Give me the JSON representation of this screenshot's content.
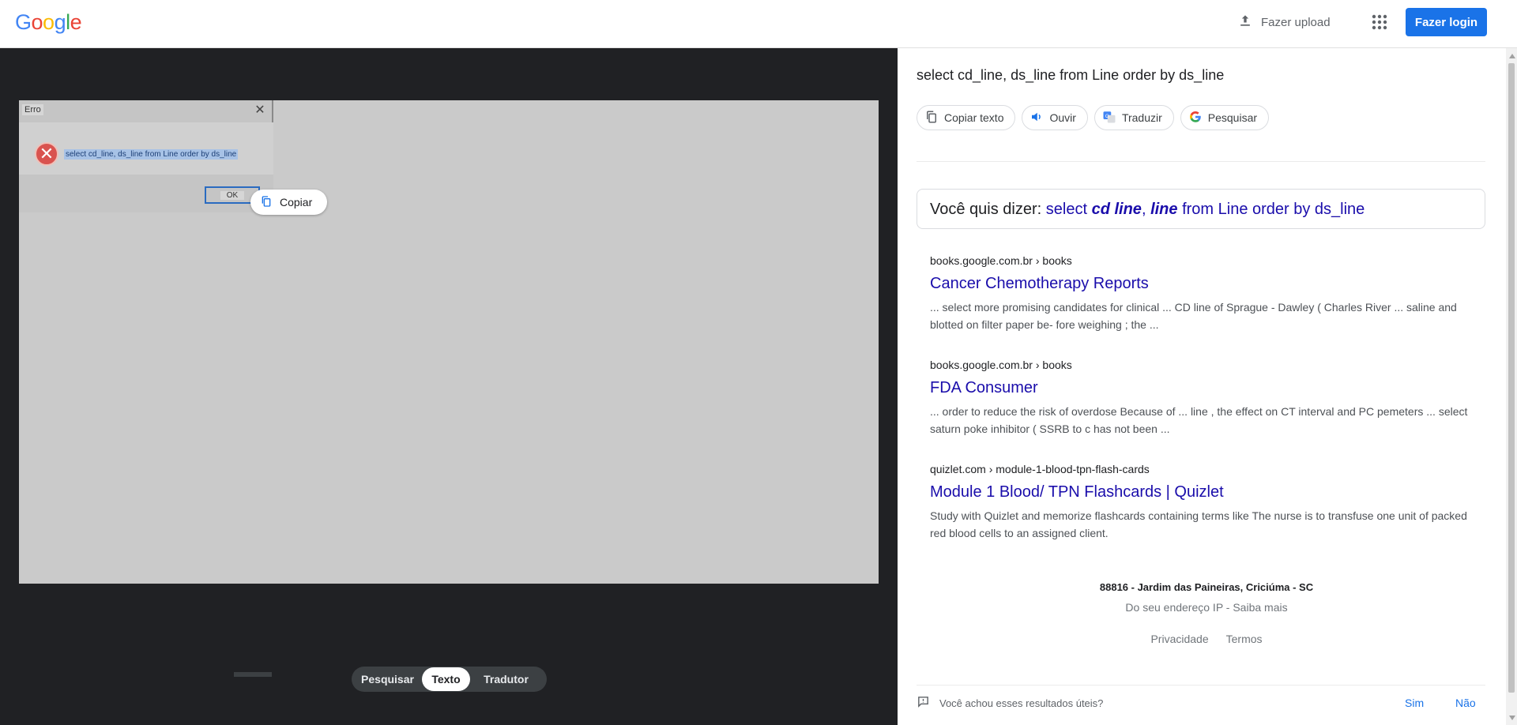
{
  "header": {
    "logo_letters": [
      "G",
      "o",
      "o",
      "g",
      "l",
      "e"
    ],
    "upload_label": "Fazer upload",
    "login_label": "Fazer login"
  },
  "image_panel": {
    "dialog": {
      "title": "Erro",
      "message": "select cd_line, ds_line from Line order by ds_line",
      "ok_label": "OK"
    },
    "copy_label": "Copiar",
    "modes": [
      "Pesquisar",
      "Texto",
      "Tradutor"
    ],
    "active_mode": "Texto"
  },
  "results_panel": {
    "query": "select cd_line, ds_line from Line order by ds_line",
    "actions": [
      "Copiar texto",
      "Ouvir",
      "Traduzir",
      "Pesquisar"
    ],
    "did_you_mean": {
      "prefix": "Você quis dizer:",
      "part1": "select ",
      "bold1": "cd line",
      "part2": ", ",
      "bold2": "line",
      "part3": " from Line order by ds_line"
    },
    "results": [
      {
        "url": "books.google.com.br › books",
        "title": "Cancer Chemotherapy Reports",
        "snippet": "... select more promising candidates for clinical ... CD line of Sprague - Dawley ( Charles River ... saline and blotted on filter paper be- fore weighing ; the ..."
      },
      {
        "url": "books.google.com.br › books",
        "title": "FDA Consumer",
        "snippet": "... order to reduce the risk of overdose Because of ... line , the effect on CT interval and PC pemeters ... select saturn poke inhibitor ( SSRB to c has not been ..."
      },
      {
        "url": "quizlet.com › module-1-blood-tpn-flash-cards",
        "title": "Module 1 Blood/ TPN Flashcards | Quizlet",
        "snippet": "Study with Quizlet and memorize flashcards containing terms like The nurse is to transfuse one unit of packed red blood cells to an assigned client."
      }
    ],
    "location": "88816 - Jardim das Paineiras, Criciúma - SC",
    "location_source": "Do seu endereço IP - Saiba mais",
    "footer_links": [
      "Privacidade",
      "Termos"
    ],
    "feedback": {
      "question": "Você achou esses resultados úteis?",
      "yes": "Sim",
      "no": "Não"
    }
  },
  "colors": {
    "link": "#1a0dab",
    "accent": "#1a73e8",
    "dark_bg": "#202124",
    "error_icon": "#d9534f"
  }
}
